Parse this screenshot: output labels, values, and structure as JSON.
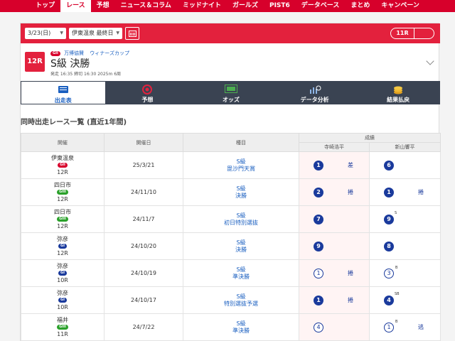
{
  "nav": [
    "トップ",
    "レース",
    "予想",
    "ニュース＆コラム",
    "ミッドナイト",
    "ガールズ",
    "PIST6",
    "データベース",
    "まとめ",
    "キャンペーン"
  ],
  "nav_active_index": 1,
  "datebar": {
    "date": "3/23(日)",
    "venue": "伊東温泉 最終日",
    "race_pager": "11R"
  },
  "race": {
    "number": "12R",
    "grade": "GII",
    "series": "万博協賛",
    "cup": "ウィナーズカップ",
    "title": "S級 決勝",
    "time": "発走 16:35 締切 16:30 2025m 6周"
  },
  "tabs": [
    {
      "label": "出走表",
      "icon": "race-card-icon"
    },
    {
      "label": "予想",
      "icon": "target-icon"
    },
    {
      "label": "オッズ",
      "icon": "odds-board-icon"
    },
    {
      "label": "データ分析",
      "icon": "analysis-chart-icon"
    },
    {
      "label": "結果払戻",
      "icon": "coins-icon"
    }
  ],
  "section_title": "同時出走レース一覧 (直近1年間)",
  "table": {
    "headers": {
      "venue": "開催",
      "date": "開催日",
      "event": "種目",
      "result": "成績",
      "rider1": "寺崎浩平",
      "rider2": "新山響平"
    },
    "rows": [
      {
        "venue": "伊東温泉",
        "grade": "GII",
        "race": "12R",
        "date": "25/3/21",
        "class": "S級",
        "event": "毘沙門天賞",
        "r1": {
          "rank": "1",
          "style": "solid",
          "note": "",
          "tag": "差"
        },
        "r2": {
          "rank": "6",
          "style": "solid",
          "note": "",
          "tag": ""
        }
      },
      {
        "venue": "四日市",
        "grade": "GIII",
        "race": "12R",
        "date": "24/11/10",
        "class": "S級",
        "event": "決勝",
        "r1": {
          "rank": "2",
          "style": "solid",
          "note": "",
          "tag": "捲"
        },
        "r2": {
          "rank": "1",
          "style": "solid",
          "note": "",
          "tag": "捲"
        }
      },
      {
        "venue": "四日市",
        "grade": "GIII",
        "race": "12R",
        "date": "24/11/7",
        "class": "S級",
        "event": "初日特別選抜",
        "r1": {
          "rank": "7",
          "style": "solid",
          "note": "",
          "tag": ""
        },
        "r2": {
          "rank": "9",
          "style": "solid",
          "note": "S",
          "tag": ""
        }
      },
      {
        "venue": "弥彦",
        "grade": "GI",
        "race": "12R",
        "date": "24/10/20",
        "class": "S級",
        "event": "決勝",
        "r1": {
          "rank": "9",
          "style": "solid",
          "note": "",
          "tag": ""
        },
        "r2": {
          "rank": "8",
          "style": "solid",
          "note": "",
          "tag": ""
        }
      },
      {
        "venue": "弥彦",
        "grade": "GI",
        "race": "10R",
        "date": "24/10/19",
        "class": "S級",
        "event": "準決勝",
        "r1": {
          "rank": "1",
          "style": "ring",
          "note": "",
          "tag": "捲"
        },
        "r2": {
          "rank": "3",
          "style": "ring",
          "note": "B",
          "tag": ""
        }
      },
      {
        "venue": "弥彦",
        "grade": "GI",
        "race": "10R",
        "date": "24/10/17",
        "class": "S級",
        "event": "特別選抜予選",
        "r1": {
          "rank": "1",
          "style": "solid",
          "note": "",
          "tag": "捲"
        },
        "r2": {
          "rank": "4",
          "style": "solid",
          "note": "SB",
          "tag": ""
        }
      },
      {
        "venue": "福井",
        "grade": "GIII",
        "race": "11R",
        "date": "24/7/22",
        "class": "S級",
        "event": "準決勝",
        "r1": {
          "rank": "4",
          "style": "ring",
          "note": "",
          "tag": ""
        },
        "r2": {
          "rank": "1",
          "style": "ring",
          "note": "B",
          "tag": "逃"
        }
      }
    ]
  },
  "colors": {
    "brand_red": "#d7002b",
    "tab_bg": "#3a4352",
    "link_blue": "#1a5fc0",
    "rank_navy": "#1a3a9c",
    "result_bg": "#fff4f4"
  }
}
